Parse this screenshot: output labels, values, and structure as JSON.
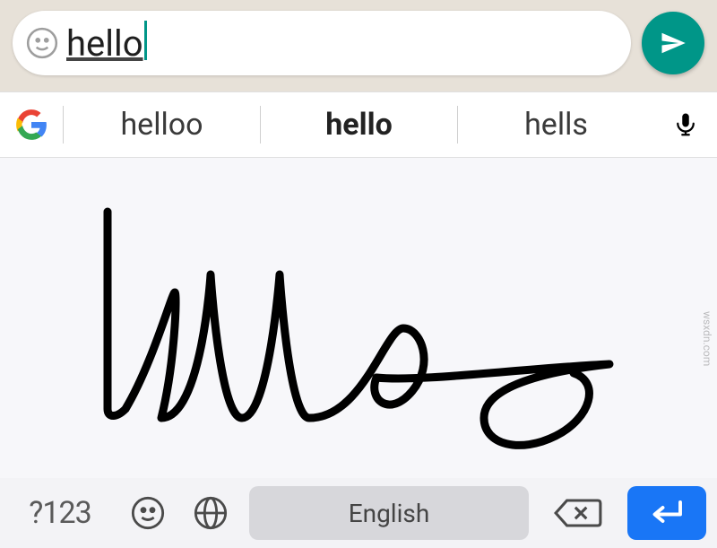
{
  "chat": {
    "input_text": "hello",
    "accent": "#009688"
  },
  "suggestions": {
    "left": "helloo",
    "center": "hello",
    "right": "hells"
  },
  "keyboard": {
    "symbol_key": "?123",
    "space_label": "English",
    "enter_color": "#1976f6"
  },
  "watermark": "wsxdn.com"
}
